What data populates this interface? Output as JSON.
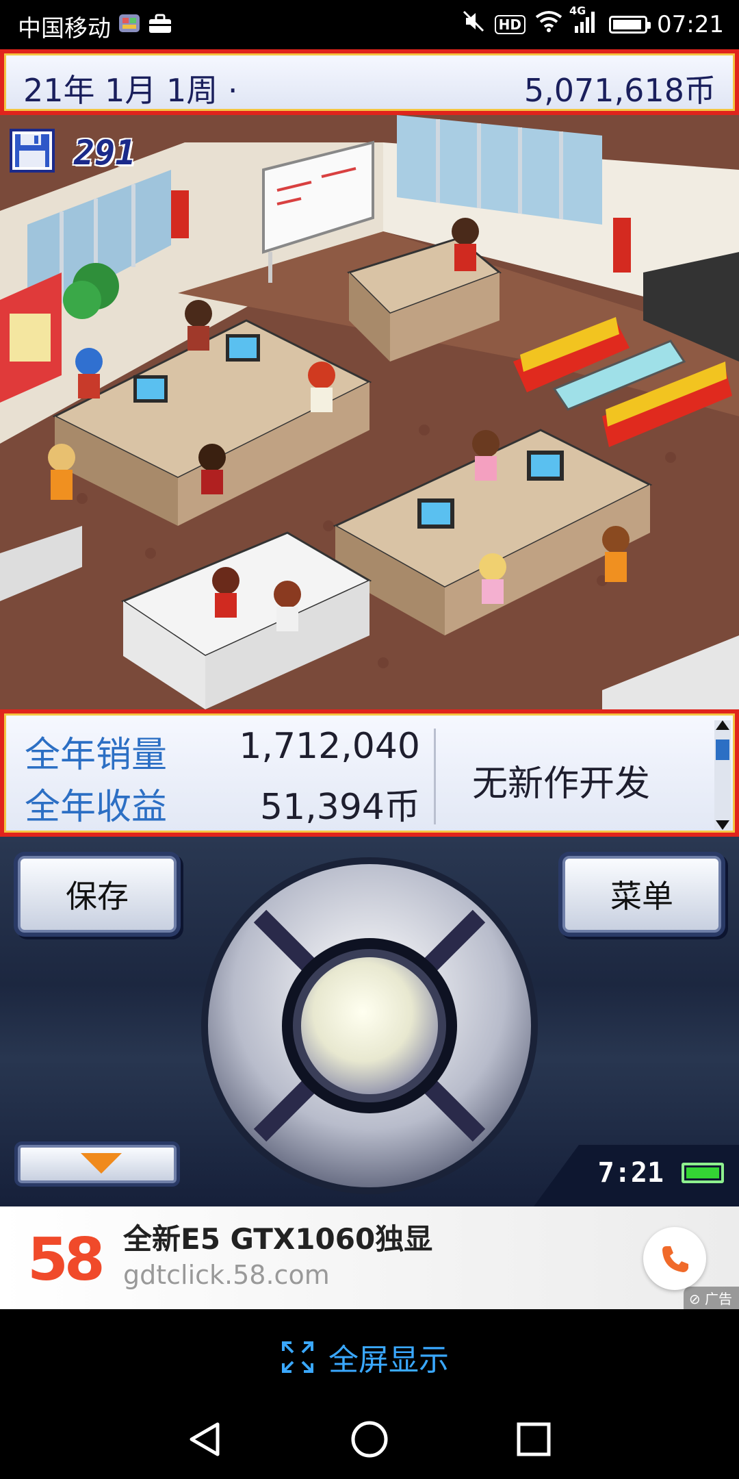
{
  "status_bar": {
    "carrier": "中国移动",
    "network": "4G",
    "hd": "HD",
    "time": "07:21"
  },
  "top_bar": {
    "date": "21年 1月 1周 ·",
    "money": "5,071,618币"
  },
  "scene": {
    "save_count": "291"
  },
  "stats": {
    "sales_label": "全年销量",
    "sales_value": "1,712,040",
    "income_label": "全年收益",
    "income_value": "51,394币",
    "dev_status": "无新作开发"
  },
  "controller": {
    "save_label": "保存",
    "menu_label": "菜单",
    "clock": "7:21"
  },
  "ad": {
    "logo": "58",
    "title": "全新E5 GTX1060独显",
    "url": "gdtclick.58.com",
    "tag": "广告"
  },
  "fullscreen": {
    "label": "全屏显示"
  },
  "colors": {
    "frame_red": "#e0241c",
    "frame_gold": "#f4c542",
    "label_blue": "#2c6fc4",
    "link_blue": "#3aa8ff"
  }
}
